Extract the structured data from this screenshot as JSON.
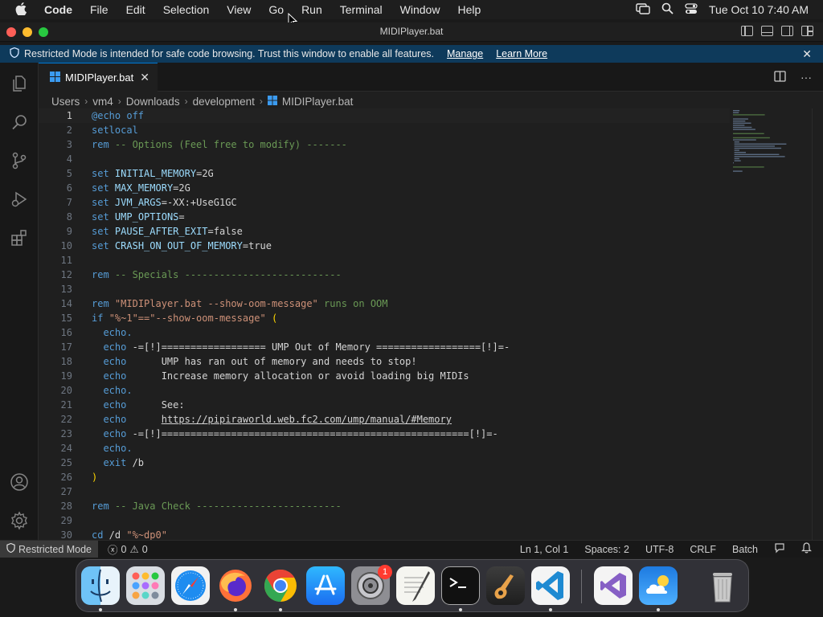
{
  "menubar": {
    "app": "Code",
    "items": [
      "File",
      "Edit",
      "Selection",
      "View",
      "Go",
      "Run",
      "Terminal",
      "Window",
      "Help"
    ],
    "clock": "Tue Oct 10  7:40 AM"
  },
  "window": {
    "title": "MIDIPlayer.bat"
  },
  "banner": {
    "message": "Restricted Mode is intended for safe code browsing. Trust this window to enable all features.",
    "manage": "Manage",
    "learn_more": "Learn More"
  },
  "tab": {
    "label": "MIDIPlayer.bat"
  },
  "breadcrumb": [
    "Users",
    "vm4",
    "Downloads",
    "development",
    "MIDIPlayer.bat"
  ],
  "code": {
    "lines": [
      "@echo off",
      "setlocal",
      "rem -- Options (Feel free to modify) -------",
      "",
      "set INITIAL_MEMORY=2G",
      "set MAX_MEMORY=2G",
      "set JVM_ARGS=-XX:+UseG1GC",
      "set UMP_OPTIONS=",
      "set PAUSE_AFTER_EXIT=false",
      "set CRASH_ON_OUT_OF_MEMORY=true",
      "",
      "rem -- Specials ---------------------------",
      "",
      "rem \"MIDIPlayer.bat --show-oom-message\" runs on OOM",
      "if \"%~1\"==\"--show-oom-message\" (",
      "  echo.",
      "  echo -=[!]================== UMP Out of Memory ==================[!]=-",
      "  echo      UMP has ran out of memory and needs to stop!",
      "  echo      Increase memory allocation or avoid loading big MIDIs",
      "  echo.",
      "  echo      See:",
      "  echo      https://pipiraworld.web.fc2.com/ump/manual/#Memory",
      "  echo -=[!]=====================================================[!]=-",
      "  echo.",
      "  exit /b",
      ")",
      "",
      "rem -- Java Check -------------------------",
      "",
      "cd /d \"%~dp0\""
    ]
  },
  "statusbar": {
    "restricted": "Restricted Mode",
    "errors": "0",
    "warnings": "0",
    "position": "Ln 1, Col 1",
    "spaces": "Spaces: 2",
    "encoding": "UTF-8",
    "eol": "CRLF",
    "language": "Batch"
  },
  "dock": {
    "badge_settings": "1"
  },
  "colors": {
    "accent": "#0078d4",
    "banner_bg": "#0e3a5b",
    "keyword": "#569cd6",
    "comment": "#6a9955",
    "string": "#ce9178"
  }
}
